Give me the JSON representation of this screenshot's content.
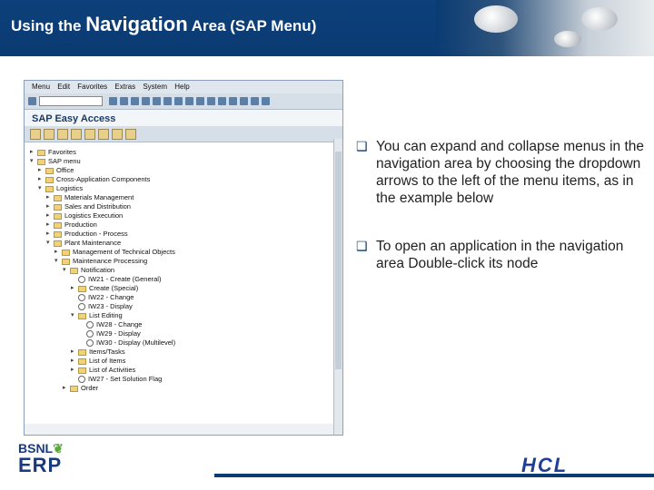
{
  "slide": {
    "title_pre": "Using the",
    "title_big": "Navigation",
    "title_post": "Area (SAP Menu)"
  },
  "sap": {
    "menubar": [
      "Menu",
      "Edit",
      "Favorites",
      "Extras",
      "System",
      "Help"
    ],
    "screen_title": "SAP Easy Access",
    "tree": [
      {
        "label": "Favorites",
        "level": 0,
        "type": "folder",
        "arrow": "▸"
      },
      {
        "label": "SAP menu",
        "level": 0,
        "type": "folder",
        "arrow": "▾"
      },
      {
        "label": "Office",
        "level": 1,
        "type": "folder",
        "arrow": "▸"
      },
      {
        "label": "Cross-Application Components",
        "level": 1,
        "type": "folder",
        "arrow": "▸"
      },
      {
        "label": "Logistics",
        "level": 1,
        "type": "folder",
        "arrow": "▾"
      },
      {
        "label": "Materials Management",
        "level": 2,
        "type": "folder",
        "arrow": "▸"
      },
      {
        "label": "Sales and Distribution",
        "level": 2,
        "type": "folder",
        "arrow": "▸"
      },
      {
        "label": "Logistics Execution",
        "level": 2,
        "type": "folder",
        "arrow": "▸"
      },
      {
        "label": "Production",
        "level": 2,
        "type": "folder",
        "arrow": "▸"
      },
      {
        "label": "Production - Process",
        "level": 2,
        "type": "folder",
        "arrow": "▸"
      },
      {
        "label": "Plant Maintenance",
        "level": 2,
        "type": "folder",
        "arrow": "▾"
      },
      {
        "label": "Management of Technical Objects",
        "level": 3,
        "type": "folder",
        "arrow": "▸"
      },
      {
        "label": "Maintenance Processing",
        "level": 3,
        "type": "folder",
        "arrow": "▾"
      },
      {
        "label": "Notification",
        "level": 4,
        "type": "folder",
        "arrow": "▾"
      },
      {
        "label": "IW21 - Create (General)",
        "level": 5,
        "type": "node",
        "arrow": ""
      },
      {
        "label": "Create (Special)",
        "level": 5,
        "type": "folder",
        "arrow": "▸"
      },
      {
        "label": "IW22 - Change",
        "level": 5,
        "type": "node",
        "arrow": ""
      },
      {
        "label": "IW23 - Display",
        "level": 5,
        "type": "node",
        "arrow": ""
      },
      {
        "label": "List Editing",
        "level": 5,
        "type": "folder",
        "arrow": "▾"
      },
      {
        "label": "IW28 - Change",
        "level": 6,
        "type": "node",
        "arrow": ""
      },
      {
        "label": "IW29 - Display",
        "level": 6,
        "type": "node",
        "arrow": ""
      },
      {
        "label": "IW30 - Display (Multilevel)",
        "level": 6,
        "type": "node",
        "arrow": ""
      },
      {
        "label": "Items/Tasks",
        "level": 5,
        "type": "folder",
        "arrow": "▸"
      },
      {
        "label": "List of Items",
        "level": 5,
        "type": "folder",
        "arrow": "▸"
      },
      {
        "label": "List of Activities",
        "level": 5,
        "type": "folder",
        "arrow": "▸"
      },
      {
        "label": "IW27 - Set Solution Flag",
        "level": 5,
        "type": "node",
        "arrow": ""
      },
      {
        "label": "Order",
        "level": 4,
        "type": "folder",
        "arrow": "▸"
      }
    ]
  },
  "bullets": [
    "You can expand and collapse menus in the navigation area by choosing the dropdown arrows to the left of the menu items, as in the example below",
    "To open an application in the navigation area Double-click its node"
  ],
  "logos": {
    "bsnl": "BSNL",
    "erp": "ERP",
    "hcl": "HCL"
  }
}
